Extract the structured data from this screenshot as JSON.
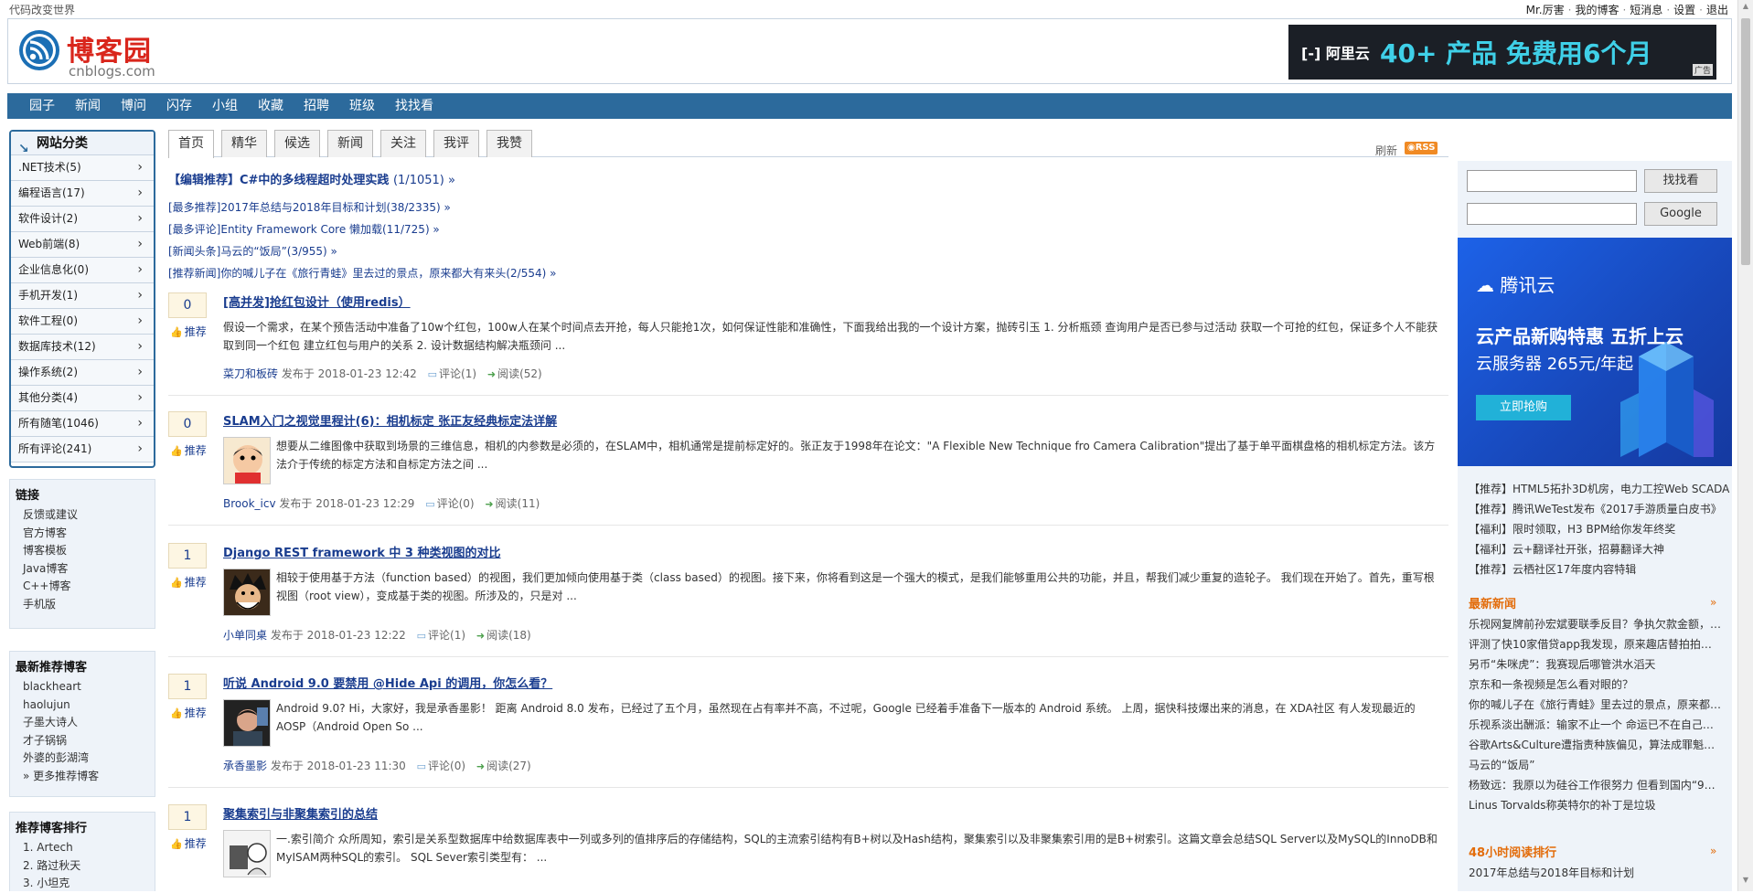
{
  "topbar": {
    "slogan": "代码改变世界",
    "user": "Mr.厉害",
    "my_blog": "我的博客",
    "messages": "短消息",
    "settings": "设置",
    "logout": "退出"
  },
  "logo": {
    "name": "博客园",
    "domain": "cnblogs.com"
  },
  "ad_banner": {
    "brand": "阿里云",
    "promo_prefix": "40+ 产品 免费用",
    "promo_highlight": "6个月",
    "tag": "广告"
  },
  "nav": [
    "园子",
    "新闻",
    "博问",
    "闪存",
    "小组",
    "收藏",
    "招聘",
    "班级",
    "找找看"
  ],
  "categories": {
    "title": "网站分类",
    "items": [
      ".NET技术(5)",
      "编程语言(17)",
      "软件设计(2)",
      "Web前端(8)",
      "企业信息化(0)",
      "手机开发(1)",
      "软件工程(0)",
      "数据库技术(12)",
      "操作系统(2)",
      "其他分类(4)",
      "所有随笔(1046)",
      "所有评论(241)"
    ]
  },
  "links": {
    "title": "链接",
    "items": [
      "反馈或建议",
      "官方博客",
      "博客模板",
      "Java博客",
      "C++博客",
      "手机版"
    ]
  },
  "new_bloggers": {
    "title": "最新推荐博客",
    "items": [
      "blackheart",
      "haolujun",
      "子墨大诗人",
      "才子锅锅",
      "外婆的彭湖湾",
      "» 更多推荐博客"
    ]
  },
  "rank": {
    "title": "推荐博客排行",
    "items": [
      "1. Artech",
      "2. 路过秋天",
      "3. 小坦克"
    ]
  },
  "tabs": [
    "首页",
    "精华",
    "候选",
    "新闻",
    "关注",
    "我评",
    "我赞"
  ],
  "refresh": "刷新",
  "rss": "RSS",
  "headline": {
    "text": "【编辑推荐】C#中的多线程超时处理实践",
    "count": "(1/1051) »"
  },
  "picks": [
    "[最多推荐]2017年总结与2018年目标和计划(38/2335) »",
    "[最多评论]Entity Framework Core 懒加载(11/725) »",
    "[新闻头条]马云的“饭局”(3/955) »",
    "[推荐新闻]你的喊儿子在《旅行青蛙》里去过的景点，原来都大有来头(2/554) »"
  ],
  "posts": [
    {
      "digg": "0",
      "rec": "推荐",
      "title": "[高并发]抢红包设计（使用redis）",
      "summary": "假设一个需求，在某个预告活动中准备了10w个红包，100w人在某个时间点去开抢，每人只能抢1次，如何保证性能和准确性，下面我给出我的一个设计方案，抛砖引玉 1. 分析瓶颈 查询用户是否已参与过活动 获取一个可抢的红包，保证多个人不能获取到同一个红包 建立红包与用户的关系 2. 设计数据结构解决瓶颈问 ...",
      "author": "菜刀和板砖",
      "published": "发布于 2018-01-23 12:42",
      "comments": "评论(1)",
      "reads": "阅读(52)"
    },
    {
      "digg": "0",
      "rec": "推荐",
      "title": "SLAM入门之视觉里程计(6)：相机标定 张正友经典标定法详解",
      "summary": "想要从二维图像中获取到场景的三维信息，相机的内参数是必须的，在SLAM中，相机通常是提前标定好的。张正友于1998年在论文：\"A Flexible New Technique fro Camera Calibration\"提出了基于单平面棋盘格的相机标定方法。该方法介于传统的标定方法和自标定方法之间 ...",
      "author": "Brook_icv",
      "published": "发布于 2018-01-23 12:29",
      "comments": "评论(0)",
      "reads": "阅读(11)"
    },
    {
      "digg": "1",
      "rec": "推荐",
      "title": "Django REST framework 中 3 种类视图的对比",
      "summary": "相较于使用基于方法（function based）的视图，我们更加倾向使用基于类（class based）的视图。接下来，你将看到这是一个强大的模式，是我们能够重用公共的功能，并且，帮我们减少重复的造轮子。 我们现在开始了。首先，重写根视图（root view），变成基于类的视图。所涉及的，只是对 ...",
      "author": "小单同桌",
      "published": "发布于 2018-01-23 12:22",
      "comments": "评论(1)",
      "reads": "阅读(18)"
    },
    {
      "digg": "1",
      "rec": "推荐",
      "title": "听说 Android 9.0 要禁用 @Hide Api 的调用，你怎么看？",
      "summary": "Android 9.0? Hi，大家好，我是承香墨影！ 距离 Android 8.0 发布，已经过了五个月，虽然现在占有率并不高，不过呢，Google 已经着手准备下一版本的 Android 系统。 上周，据快科技爆出来的消息，在 XDA社区 有人发现最近的 AOSP（Android Open So ...",
      "author": "承香墨影",
      "published": "发布于 2018-01-23 11:30",
      "comments": "评论(0)",
      "reads": "阅读(27)"
    },
    {
      "digg": "1",
      "rec": "推荐",
      "title": "聚集索引与非聚集索引的总结",
      "summary": "一.索引简介 众所周知，索引是关系型数据库中给数据库表中一列或多列的值排序后的存储结构，SQL的主流索引结构有B+树以及Hash结构，聚集索引以及非聚集索引用的是B+树索引。这篇文章会总结SQL Server以及MySQL的InnoDB和MyISAM两种SQL的索引。 SQL Sever索引类型有： ..."
    }
  ],
  "right": {
    "search_button": "找找看",
    "google_button": "Google",
    "tencent": {
      "brand": "腾讯云",
      "line1": "云产品新购特惠 五折上云",
      "line2": "云服务器 265元/年起",
      "button": "立即抢购"
    },
    "ads": [
      "【推荐】HTML5拓扑3D机房，电力工控Web SCADA",
      "【推荐】腾讯WeTest发布《2017手游质量白皮书》",
      "【福利】限时领取，H3 BPM给你发年终奖",
      "【福利】云+翻译社开张，招募翻译大神",
      "【推荐】云栖社区17年度内容特辑"
    ],
    "news_title": "最新新闻",
    "news_more": "»",
    "news": [
      "乐视网复牌前孙宏斌要联季反目？争执欠款金额，…",
      "评测了快10家借贷app我发现，原来趣店替拍拍贷…",
      "另币“朱咪虎”：我赛现后哪管洪水滔天",
      "京东和一条视频是怎么看对眼的？",
      "你的喊儿子在《旅行青蛙》里去过的景点，原来都…",
      "乐视系淡出酬派：输家不止一个 命运已不在自己手中",
      "谷歌Arts&Culture遭指责种族偏见，算法成罪魁祸…",
      "马云的“饭局”",
      "杨致远：我原以为硅谷工作很努力 但看到国内“996…",
      "Linus Torvalds称英特尔的补丁是垃圾"
    ],
    "hot_title": "48小时阅读排行",
    "hot_more": "»",
    "hot": [
      "2017年总结与2018年目标和计划"
    ]
  }
}
